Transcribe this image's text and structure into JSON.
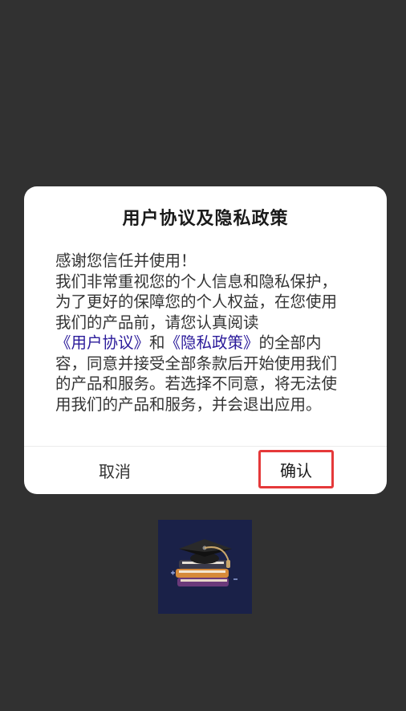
{
  "dialog": {
    "title": "用户协议及隐私政策",
    "body_prefix": "感谢您信任并使用！\n我们非常重视您的个人信息和隐私保护，为了更好的保障您的个人权益，在您使用我们的产品前，请您认真阅读",
    "link_user_agreement": "《用户协议》",
    "conjunction": "和",
    "link_privacy_policy": "《隐私政策》",
    "body_suffix": "的全部内容，同意并接受全部条款后开始使用我们的产品和服务。若选择不同意，将无法使用我们的产品和服务，并会退出应用。",
    "cancel_label": "取消",
    "confirm_label": "确认"
  },
  "colors": {
    "background": "#313131",
    "link": "#2a1a9a",
    "highlight_border": "#e5393a",
    "logo_bg": "#1a2148"
  },
  "icons": {
    "app_logo": "graduation-cap-on-books-icon"
  }
}
